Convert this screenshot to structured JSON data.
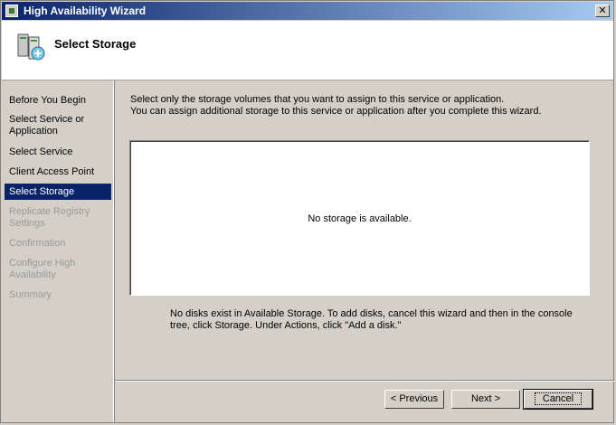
{
  "window": {
    "title": "High Availability Wizard",
    "close_glyph": "✕"
  },
  "header": {
    "title": "Select Storage",
    "icon": "server-storage-icon"
  },
  "steps": [
    {
      "label": "Before You Begin",
      "state": "done"
    },
    {
      "label": "Select Service or Application",
      "state": "done"
    },
    {
      "label": "Select Service",
      "state": "done"
    },
    {
      "label": "Client Access Point",
      "state": "done"
    },
    {
      "label": "Select Storage",
      "state": "current"
    },
    {
      "label": "Replicate Registry Settings",
      "state": "disabled"
    },
    {
      "label": "Confirmation",
      "state": "disabled"
    },
    {
      "label": "Configure High Availability",
      "state": "disabled"
    },
    {
      "label": "Summary",
      "state": "disabled"
    }
  ],
  "content": {
    "instruction_1": "Select only the storage volumes that you want to assign to this service or application.",
    "instruction_2": "You can assign additional storage to this service or application after you complete this wizard.",
    "empty_message": "No storage is available.",
    "note": "No disks exist in Available Storage.  To add disks, cancel this wizard and then in the console tree, click Storage. Under Actions, click \"Add a disk.\""
  },
  "buttons": {
    "previous": "< Previous",
    "next": "Next >",
    "cancel": "Cancel"
  }
}
